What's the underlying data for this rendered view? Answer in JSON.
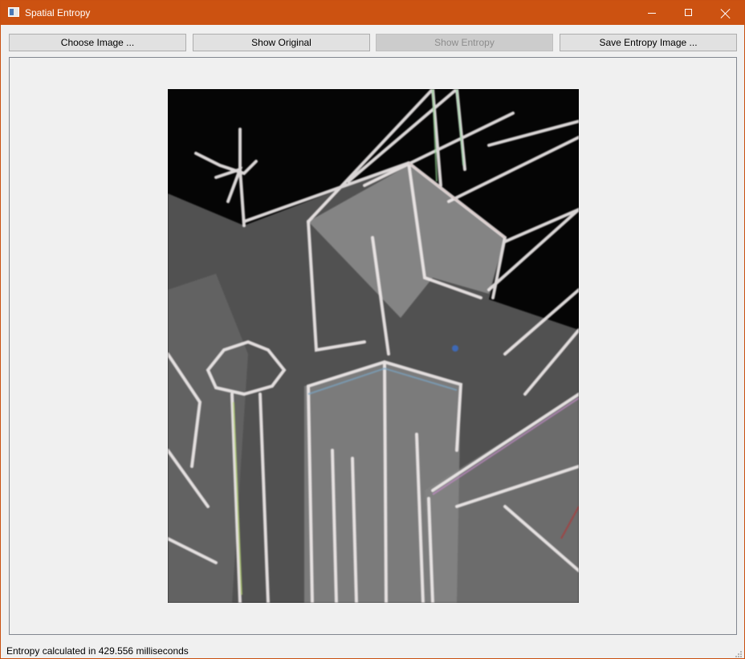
{
  "window": {
    "title": "Spatial Entropy",
    "controls": {
      "minimize": "minimize-icon",
      "maximize": "maximize-icon",
      "close": "close-icon"
    }
  },
  "toolbar": {
    "choose_label": "Choose Image ...",
    "original_label": "Show Original",
    "entropy_label": "Show Entropy",
    "save_label": "Save Entropy Image ..."
  },
  "image": {
    "description": "entropy-image",
    "background": "#050505"
  },
  "status": {
    "text": "Entropy calculated in 429.556 milliseconds"
  },
  "colors": {
    "titlebar": "#cc5211",
    "window_bg": "#f0f0f0",
    "button_bg": "#e1e1e1",
    "button_disabled_bg": "#cccccc"
  }
}
